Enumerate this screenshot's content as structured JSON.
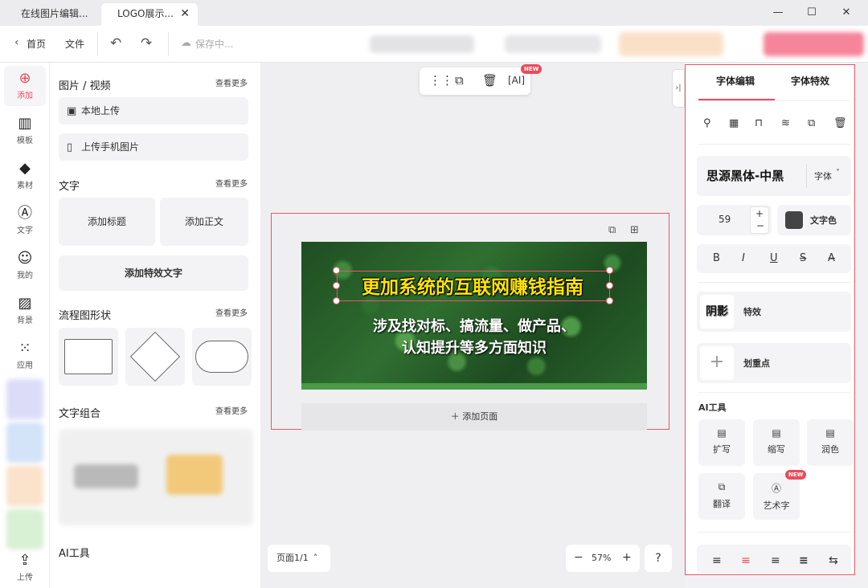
{
  "tabs": [
    {
      "label": "在线图片编辑..."
    },
    {
      "label": "LOGO展示...",
      "close": "✕"
    }
  ],
  "window_controls": {
    "minimize": "—",
    "maximize": "☐",
    "close": "✕"
  },
  "toolbar": {
    "home": "首页",
    "file": "文件",
    "save_status": "保存中..."
  },
  "rail": {
    "items": [
      {
        "label": "添加",
        "icon": "plus-circle-icon"
      },
      {
        "label": "模板",
        "icon": "template-icon"
      },
      {
        "label": "素材",
        "icon": "shapes-icon"
      },
      {
        "label": "文字",
        "icon": "text-icon"
      },
      {
        "label": "我的",
        "icon": "user-icon"
      },
      {
        "label": "背景",
        "icon": "background-icon"
      },
      {
        "label": "应用",
        "icon": "apps-icon"
      }
    ],
    "upload": "上传"
  },
  "assets": {
    "media_title": "图片 / 视频",
    "more": "查看更多",
    "local_upload": "本地上传",
    "phone_upload": "上传手机图片",
    "text_title": "文字",
    "add_heading": "添加标题",
    "add_body": "添加正文",
    "add_effect_text": "添加特效文字",
    "flow_title": "流程图形状",
    "text_combo_title": "文字组合",
    "ai_title": "AI工具"
  },
  "floatbar": {
    "new_badge": "NEW"
  },
  "canvas": {
    "title": "更加系统的互联网赚钱指南",
    "subtitle_line1": "涉及找对标、搞流量、做产品、",
    "subtitle_line2": "认知提升等多方面知识",
    "add_page": "添加页面",
    "pager": "页面1/1",
    "zoom": "57%",
    "zoom_out": "−",
    "zoom_in": "+",
    "help": "?"
  },
  "right_panel": {
    "tab_font_edit": "字体编辑",
    "tab_font_effect": "字体特效",
    "font_name": "思源黑体-中黑",
    "font_dropdown": "字体",
    "font_size": "59",
    "text_color_label": "文字色",
    "text_color": "#444444",
    "format": {
      "bold": "B",
      "italic": "I",
      "underline": "U",
      "strike": "S"
    },
    "shadow_preview": "阴影",
    "effect_label": "特效",
    "highlight_label": "划重点",
    "ai_title": "AI工具",
    "ai_tools": [
      {
        "label": "扩写"
      },
      {
        "label": "缩写"
      },
      {
        "label": "润色"
      },
      {
        "label": "翻译"
      },
      {
        "label": "艺术字"
      }
    ],
    "new_badge": "NEW"
  },
  "colors": {
    "accent": "#e94c5c",
    "title_yellow": "#ffe600"
  }
}
